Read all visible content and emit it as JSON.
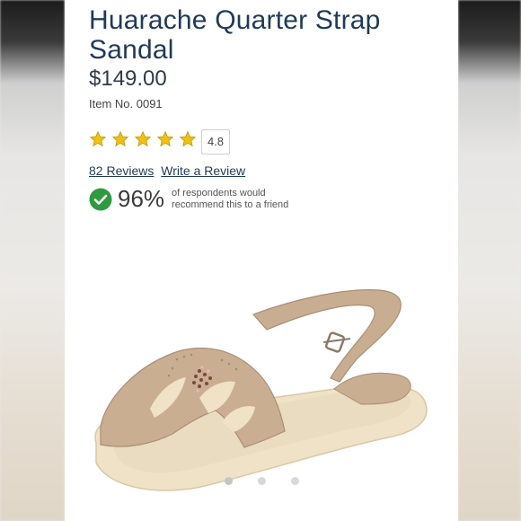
{
  "product": {
    "title": "Huarache Quarter Strap Sandal",
    "price": "$149.00",
    "item_number": "Item No. 0091"
  },
  "rating": {
    "stars": 5,
    "value": "4.8",
    "reviews_link": "82 Reviews",
    "write_review_link": "Write a Review"
  },
  "recommend": {
    "percent": "96%",
    "text": "of respondents would recommend this to a friend",
    "icon": "check-circle-icon"
  },
  "gallery": {
    "image_count": 3,
    "active_index": 0
  },
  "colors": {
    "title": "#1f3a5a",
    "star": "#f2c200",
    "check": "#2e9b3f"
  }
}
